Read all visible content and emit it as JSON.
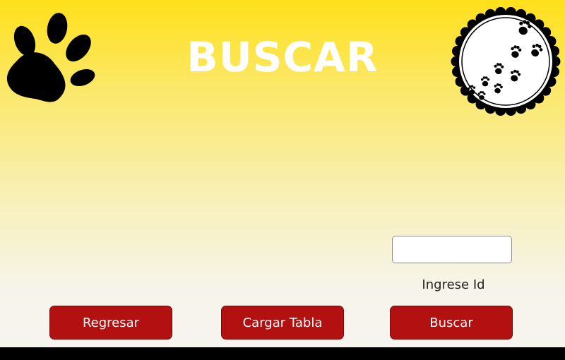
{
  "page": {
    "title": "BUSCAR",
    "background_top_color": "#ffe01a",
    "background_bottom_color": "#f5f4ef"
  },
  "icons": {
    "logo": "paw-print-icon",
    "seal": "paw-tracks-seal-icon"
  },
  "search": {
    "input_value": "",
    "label": "Ingrese Id"
  },
  "buttons": {
    "back_label": "Regresar",
    "load_table_label": "Cargar Tabla",
    "search_label": "Buscar",
    "color": "#b31111"
  }
}
